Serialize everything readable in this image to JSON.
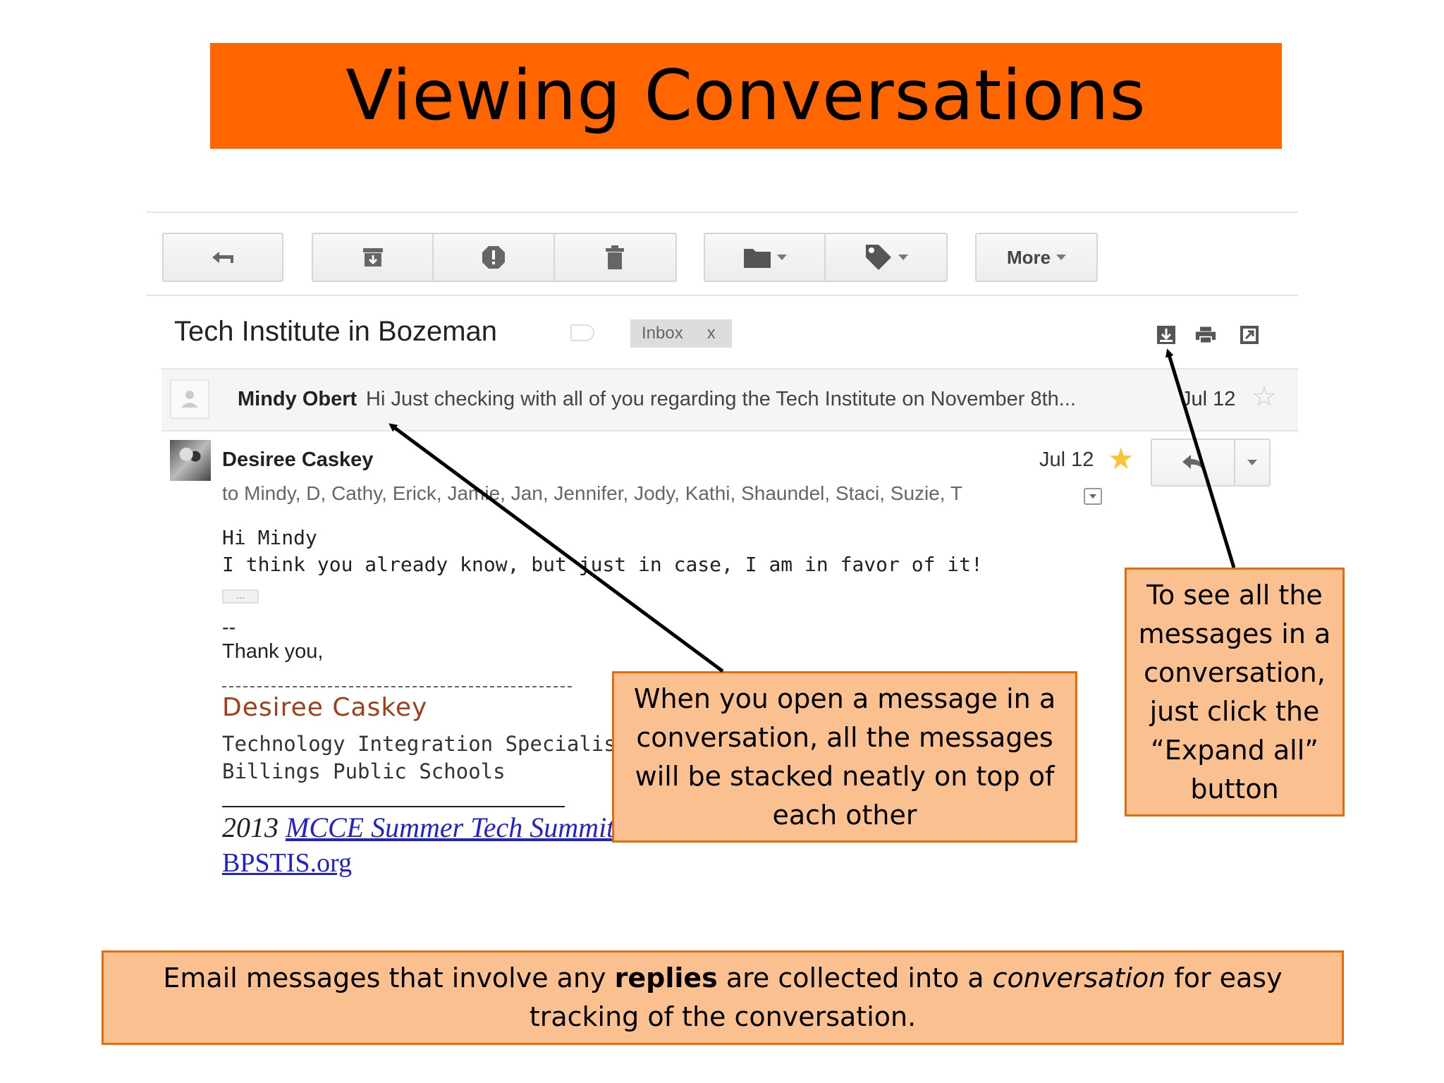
{
  "slide": {
    "title": "Viewing Conversations"
  },
  "toolbar": {
    "icons": [
      "reply-icon",
      "archive-icon",
      "report-spam-icon",
      "delete-icon",
      "move-to-folder-icon",
      "labels-icon"
    ],
    "more_label": "More"
  },
  "thread": {
    "subject": "Inbox label area",
    "title": "Tech Institute in Bozeman",
    "label": "Inbox",
    "label_remove": "x",
    "header_icons": [
      "expand-all-icon",
      "print-icon",
      "new-window-icon"
    ]
  },
  "collapsed_message": {
    "sender": "Mindy Obert",
    "snippet": "Hi Just checking with all of you regarding the Tech Institute on November 8th...",
    "date": "Jul 12",
    "starred": false
  },
  "open_message": {
    "sender": "Desiree Caskey",
    "date": "Jul 12",
    "starred": true,
    "to_line": "to Mindy, D, Cathy, Erick, Jamie, Jan, Jennifer, Jody, Kathi, Shaundel, Staci, Suzie, T",
    "greeting": "Hi Mindy",
    "body": "I think you already know, but just in case, I am in favor of it!",
    "ellipsis": "...",
    "sig_dashes": "--",
    "closing": "Thank you,",
    "sig_name": "Desiree Caskey",
    "sig_title": "Technology Integration Specialist",
    "sig_org": "Billings Public Schools",
    "summit_year": "2013",
    "summit_link": "MCCE Summer Tech Summit",
    "site_link": "BPSTIS.org"
  },
  "callouts": {
    "middle": "When you open a message in a conversation, all the messages will be stacked neatly on top of each other",
    "right": "To see all the messages in a conversation, just click the “Expand all” button",
    "bottom_pre": "Email messages that involve any ",
    "bottom_bold": "replies",
    "bottom_mid": " are collected into a ",
    "bottom_italic": "conversation",
    "bottom_post": " for easy tracking of the conversation."
  },
  "colors": {
    "title_banner": "#ff6600",
    "callout_fill": "#fac090",
    "callout_border": "#e46c0a",
    "star_active": "#f7c533",
    "link": "#2222cc"
  }
}
